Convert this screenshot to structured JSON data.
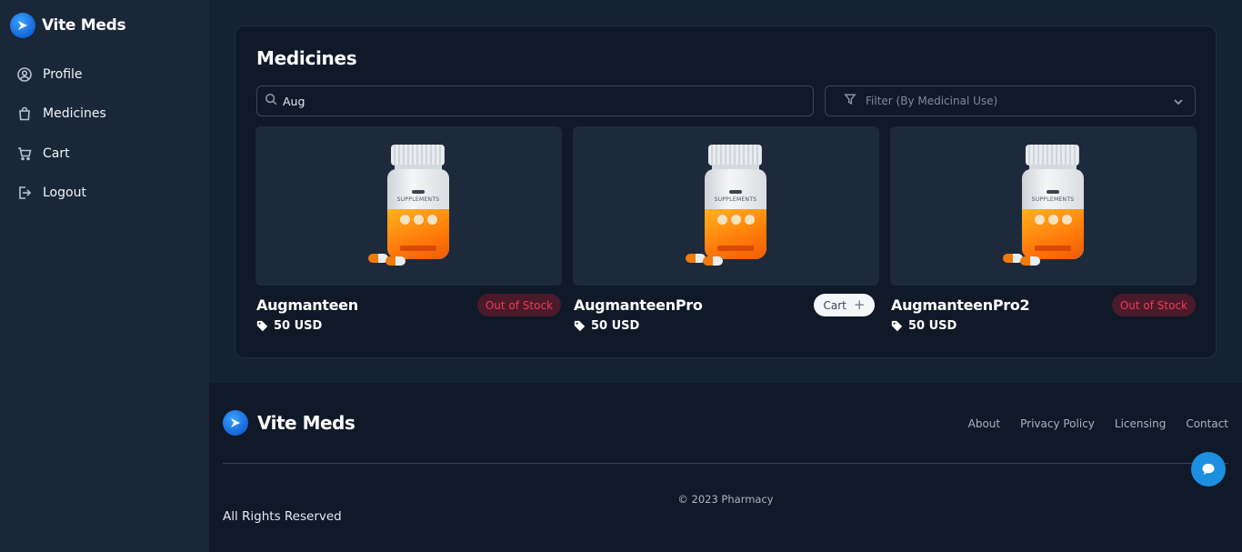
{
  "sidebar": {
    "brand": "Vite Meds",
    "items": [
      {
        "label": "Profile",
        "icon": "user-circle-icon"
      },
      {
        "label": "Medicines",
        "icon": "shopping-bag-icon"
      },
      {
        "label": "Cart",
        "icon": "cart-icon"
      },
      {
        "label": "Logout",
        "icon": "logout-icon"
      }
    ]
  },
  "main": {
    "title": "Medicines",
    "search": {
      "value": "Aug",
      "icon": "search-icon"
    },
    "filter": {
      "placeholder": "Filter (By Medicinal Use)",
      "icon": "filter-icon"
    },
    "products": [
      {
        "name": "Augmanteen",
        "price": "50 USD",
        "status": "Out of Stock"
      },
      {
        "name": "AugmanteenPro",
        "price": "50 USD",
        "action": "Cart"
      },
      {
        "name": "AugmanteenPro2",
        "price": "50 USD",
        "status": "Out of Stock"
      }
    ]
  },
  "footer": {
    "brand": "Vite Meds",
    "links": [
      "About",
      "Privacy Policy",
      "Licensing",
      "Contact"
    ],
    "copyright": "© 2023 Pharmacy",
    "rights": "All Rights Reserved"
  },
  "colors": {
    "accent": "#1c8fe0",
    "out_of_stock_text": "#ef3b56",
    "out_of_stock_bg": "#4a1a2a",
    "sidebar_bg": "#1a2738",
    "panel_bg": "#0f1928"
  }
}
